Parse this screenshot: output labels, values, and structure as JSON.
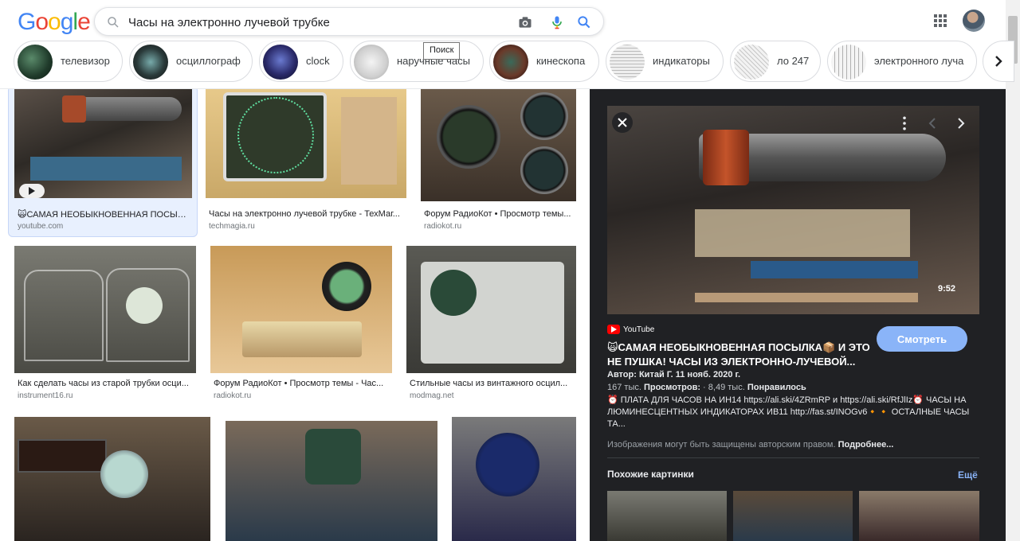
{
  "search": {
    "query": "Часы на электронно лучевой трубке",
    "tooltip": "Поиск"
  },
  "logo": [
    "G",
    "o",
    "o",
    "g",
    "l",
    "e"
  ],
  "logo_colors": [
    "#4285f4",
    "#ea4335",
    "#fbbc05",
    "#4285f4",
    "#34a853",
    "#ea4335"
  ],
  "chips": [
    {
      "label": "телевизор"
    },
    {
      "label": "осциллограф"
    },
    {
      "label": "clock"
    },
    {
      "label": "наручные часы"
    },
    {
      "label": "кинескопа"
    },
    {
      "label": "индикаторы"
    },
    {
      "label": "ло 247"
    },
    {
      "label": "электронного луча"
    }
  ],
  "results": [
    {
      "title": "🙀САМАЯ НЕОБЫКНОВЕННАЯ ПОСЫЛК...",
      "source": "youtube.com"
    },
    {
      "title": "Часы на электронно лучевой трубке - ТехМаг...",
      "source": "techmagia.ru"
    },
    {
      "title": "Форум РадиоКот • Просмотр темы...",
      "source": "radiokot.ru"
    },
    {
      "title": "Как сделать часы из старой трубки осци...",
      "source": "instrument16.ru"
    },
    {
      "title": "Форум РадиоКот • Просмотр темы - Час...",
      "source": "radiokot.ru"
    },
    {
      "title": "Стильные часы из винтажного осцил...",
      "source": "modmag.net"
    }
  ],
  "panel": {
    "duration": "9:52",
    "source": "YouTube",
    "title": "🙀САМАЯ НЕОБЫКНОВЕННАЯ ПОСЫЛКА📦 И ЭТО НЕ ПУШКА! ЧАСЫ ИЗ ЭЛЕКТРОННО-ЛУЧЕВОЙ...",
    "watch_label": "Смотреть",
    "author_label": "Автор:",
    "author": "Китай Г.",
    "date": "11 нояб. 2020 г.",
    "views": "167 тыс.",
    "views_label": "Просмотров:",
    "likes": "8,49 тыс.",
    "likes_label": "Понравилось",
    "description": "⏰ ПЛАТА ДЛЯ ЧАСОВ НА ИН14 https://ali.ski/4ZRmRP и https://ali.ski/RfJlIz⏰ ЧАСЫ НА ЛЮМИНЕСЦЕНТНЫХ ИНДИКАТОРАХ ИВ11 http://fas.st/INOGv6🔸🔸 ОСТАЛНЫЕ ЧАСЫ ТА...",
    "copyright": "Изображения могут быть защищены авторским правом.",
    "copyright_link": "Подробнее...",
    "similar_title": "Похожие картинки",
    "similar_more": "Ещё"
  },
  "colors": {
    "accent": "#1a73e8",
    "panel_bg": "#202124",
    "watch_btn": "#8ab4f8",
    "youtube_red": "#ff0000"
  },
  "icons": [
    "search-icon",
    "camera-icon",
    "mic-icon",
    "apps-icon",
    "chevron-right-icon",
    "close-icon",
    "more-vert-icon",
    "chevron-left-icon",
    "play-icon",
    "youtube-icon"
  ]
}
